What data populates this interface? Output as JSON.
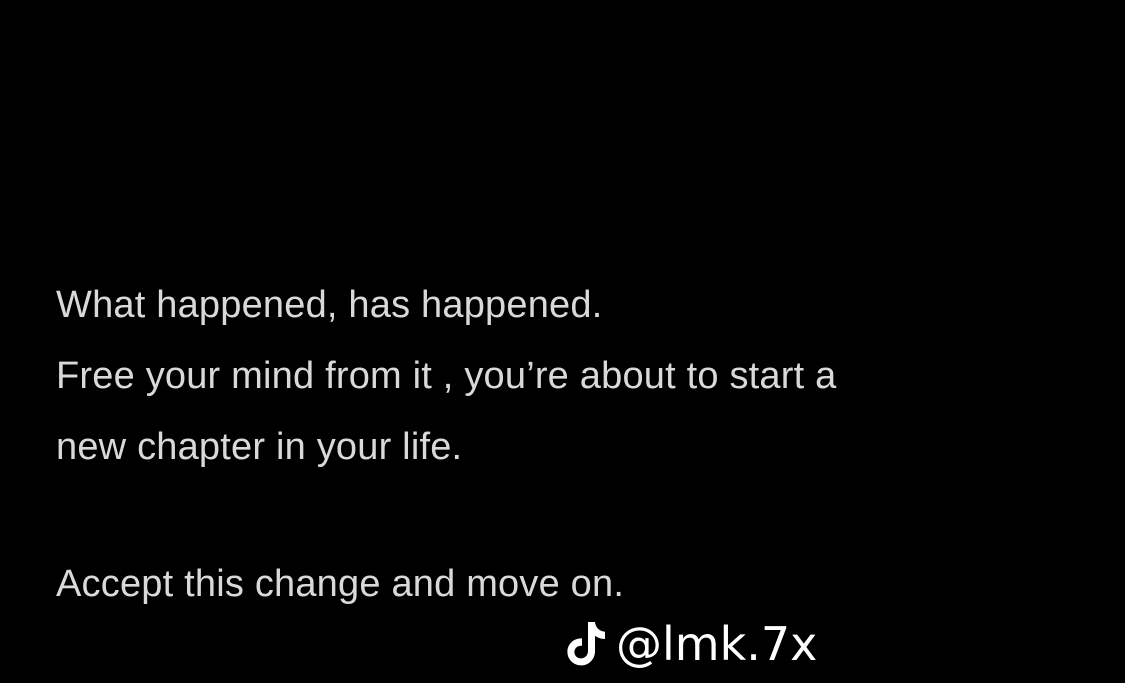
{
  "note": {
    "lines": [
      "What happened, has happened.",
      "Free your mind from it , you’re about to start a",
      "new chapter in your life.",
      "Accept this change and move on."
    ]
  },
  "watermark": {
    "icon": "tiktok-logo-icon",
    "handle": "@lmk.7x"
  },
  "colors": {
    "background": "#000000",
    "text": "#d9d9d9",
    "watermark": "#ffffff"
  }
}
